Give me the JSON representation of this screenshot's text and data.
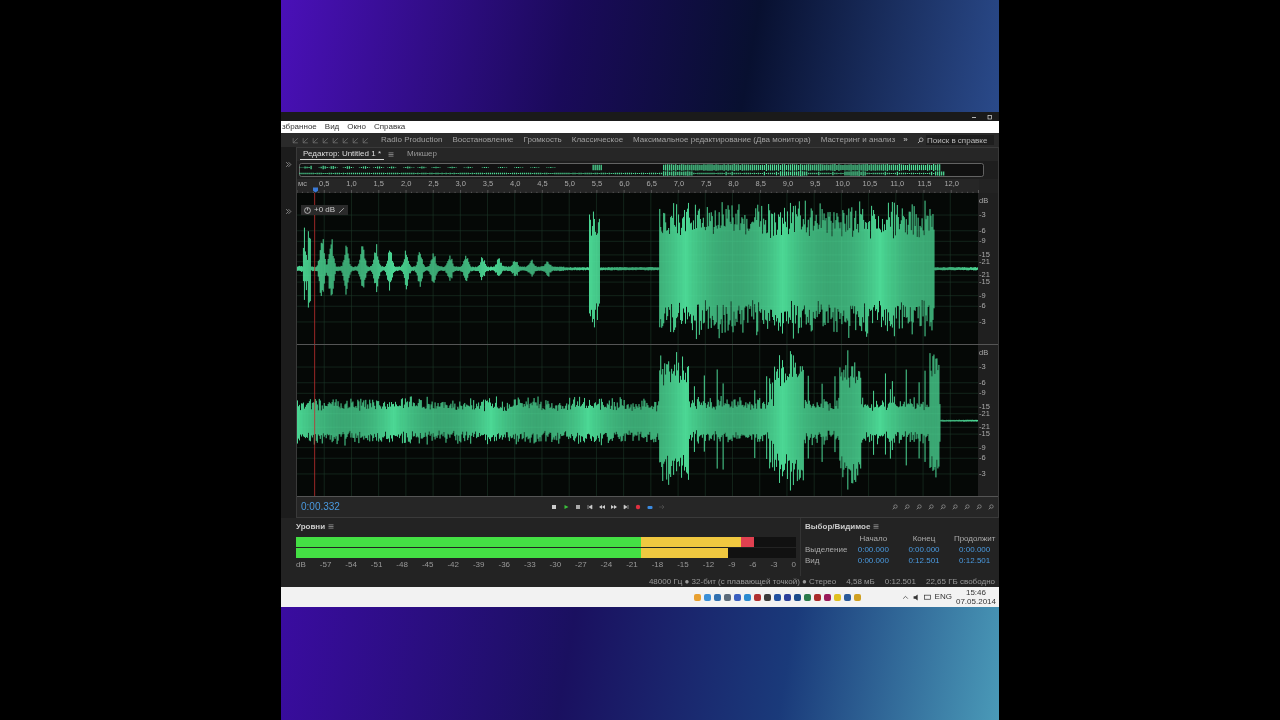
{
  "menu": [
    "збранное",
    "Вид",
    "Окно",
    "Справка"
  ],
  "workspaces": [
    {
      "label": "Radio Production",
      "selected": false
    },
    {
      "label": "Восстановление",
      "selected": false
    },
    {
      "label": "Громкость",
      "selected": false
    },
    {
      "label": "Классическое",
      "selected": false
    },
    {
      "label": "Максимальное редактирование (Два монитора)",
      "selected": false
    },
    {
      "label": "Мастеринг и анализ",
      "selected": false
    }
  ],
  "more": "»",
  "help_search": {
    "placeholder": "Поиск в справке"
  },
  "panel_tabs": [
    {
      "label": "Редактор: Untitled 1 *",
      "selected": true
    },
    {
      "label": "Микшер",
      "selected": false
    }
  ],
  "ruler": {
    "unit": "мс",
    "ticks": [
      "0,5",
      "1,0",
      "1,5",
      "2,0",
      "2,5",
      "3,0",
      "3,5",
      "4,0",
      "4,5",
      "5,0",
      "5,5",
      "6,0",
      "6,5",
      "7,0",
      "7,5",
      "8,0",
      "8,5",
      "9,0",
      "9,5",
      "10,0",
      "10,5",
      "11,0",
      "11,5",
      "12,0"
    ]
  },
  "hud": {
    "gain": "+0 dB"
  },
  "channels": [
    {
      "scale": [
        "dB",
        "-3",
        "-6",
        "-9",
        "-15",
        "-21",
        "-21",
        "-15",
        "-9",
        "-6",
        "-3"
      ]
    },
    {
      "scale": [
        "dB",
        "-3",
        "-6",
        "-9",
        "-15",
        "-21",
        "-21",
        "-15",
        "-9",
        "-6",
        "-3"
      ]
    }
  ],
  "transport": {
    "time": "0:00.332"
  },
  "levels": {
    "title": "Уровни",
    "meters": [
      {
        "level": 0.916
      },
      {
        "level": 0.864
      }
    ],
    "scale": [
      "dB",
      "-57",
      "-54",
      "-51",
      "-48",
      "-45",
      "-42",
      "-39",
      "-36",
      "-33",
      "-30",
      "-27",
      "-24",
      "-21",
      "-18",
      "-15",
      "-12",
      "-9",
      "-6",
      "-3",
      "0"
    ]
  },
  "selection_view": {
    "title": "Выбор/Видимое",
    "columns": [
      "Начало",
      "Конец",
      "Продолжит"
    ],
    "rows": [
      {
        "label": "Выделение",
        "values": [
          "0:00.000",
          "0:00.000",
          "0:00.000"
        ]
      },
      {
        "label": "Вид",
        "values": [
          "0:00.000",
          "0:12.501",
          "0:12.501"
        ]
      }
    ]
  },
  "status_bar": [
    "48000 Гц ● 32-бит (с плавающей точкой) ● Стерео",
    "4,58 мБ",
    "0:12.501",
    "22,65 ГБ свободно"
  ],
  "taskbar": {
    "language": "ENG",
    "time": "15:46",
    "date": "07.05.2014"
  }
}
